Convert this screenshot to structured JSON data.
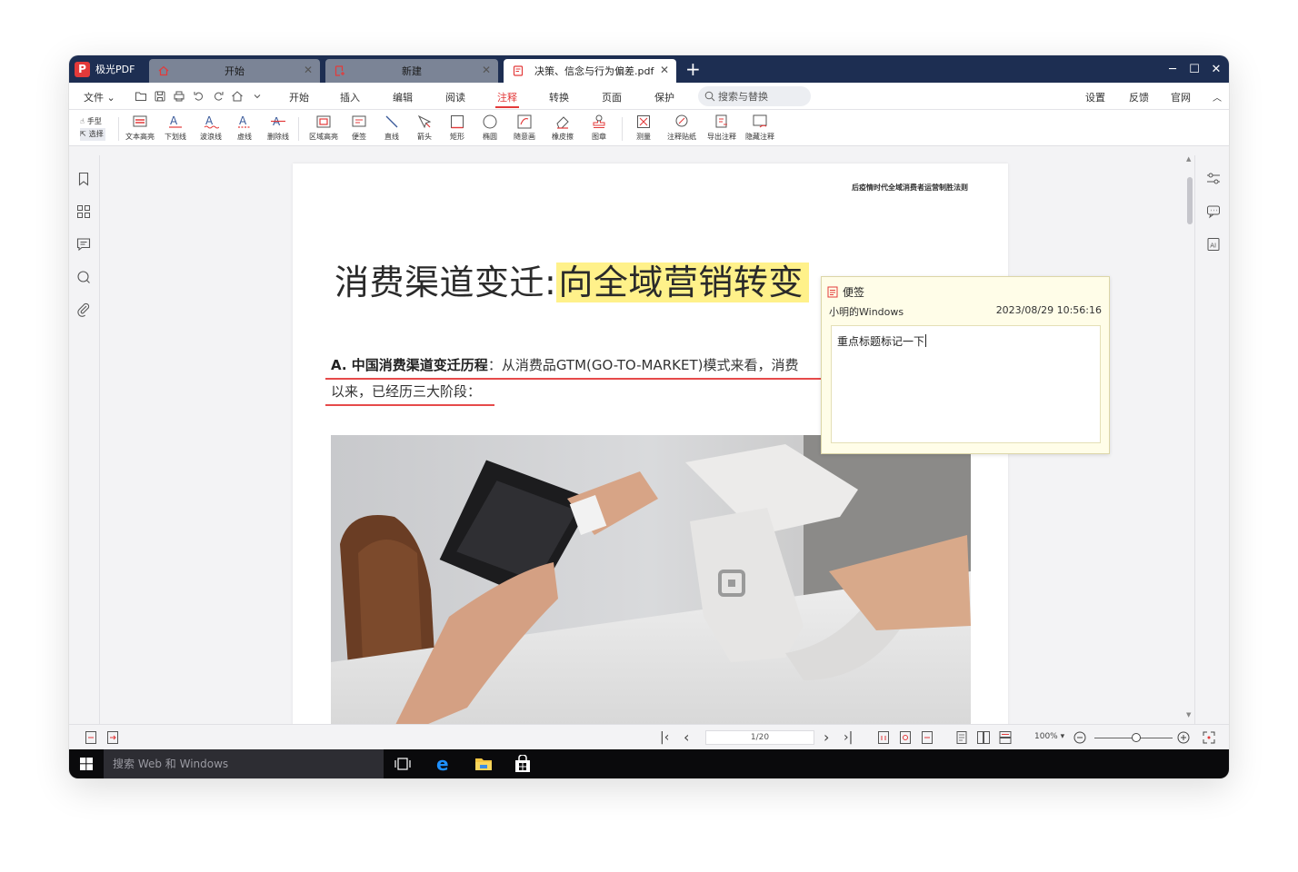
{
  "app": {
    "name": "极光PDF"
  },
  "tabs": [
    {
      "label": "开始",
      "icon": "home-icon"
    },
    {
      "label": "新建",
      "icon": "new-doc-icon"
    },
    {
      "label": "决策、信念与行为偏差.pdf",
      "icon": "pdf-file-icon"
    }
  ],
  "window_controls": {
    "minimize": "─",
    "maximize": "☐",
    "close": "✕",
    "new_tab": "+"
  },
  "menu": {
    "file": "文件",
    "items": [
      "开始",
      "插入",
      "编辑",
      "阅读",
      "注释",
      "转换",
      "页面",
      "保护"
    ],
    "active": "注释",
    "search_placeholder": "搜索与替换",
    "right": [
      "设置",
      "反馈",
      "官网"
    ]
  },
  "ribbon": {
    "hand": "手型",
    "select": "选择",
    "tools": [
      "文本高亮",
      "下划线",
      "波浪线",
      "虚线",
      "删除线",
      "区域高亮",
      "便签",
      "直线",
      "箭头",
      "矩形",
      "椭圆",
      "随意画",
      "橡皮擦",
      "图章",
      "测量",
      "注释贴纸",
      "导出注释",
      "隐藏注释"
    ]
  },
  "document": {
    "header_note": "后疫情时代全域消费者运营制胜法则",
    "title_plain": "消费渠道变迁:",
    "title_highlight": "向全域营销转变",
    "para_bold": "A. 中国消费渠道变迁历程",
    "para_line1": "：从消费品GTM(GO-TO-MARKET)模式来看，消费",
    "para_line2": "以来，已经历三大阶段："
  },
  "sticky_note": {
    "title": "便签",
    "author": "小明的Windows",
    "timestamp": "2023/08/29 10:56:16",
    "content": "重点标题标记一下"
  },
  "status": {
    "page": "1/20",
    "zoom": "100%"
  },
  "taskbar": {
    "search_placeholder": "搜索 Web 和 Windows"
  },
  "colors": {
    "accent": "#e33a3a",
    "titlebar": "#1d2e52",
    "highlight": "#fff18a",
    "underline": "#e64a4a"
  }
}
